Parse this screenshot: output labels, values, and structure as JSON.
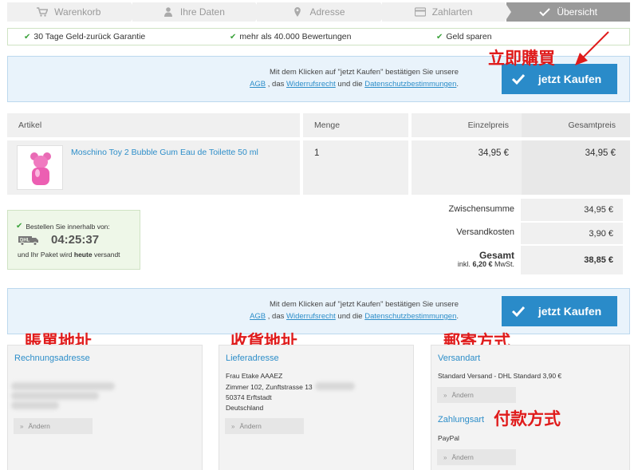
{
  "steps": [
    {
      "label": "Warenkorb",
      "icon": "cart-icon"
    },
    {
      "label": "Ihre Daten",
      "icon": "user-icon"
    },
    {
      "label": "Adresse",
      "icon": "map-pin-icon"
    },
    {
      "label": "Zahlarten",
      "icon": "credit-card-icon"
    },
    {
      "label": "Übersicht",
      "icon": "check-icon"
    }
  ],
  "guarantees": [
    "30 Tage Geld-zurück Garantie",
    "mehr als 40.000 Bewertungen",
    "Geld sparen"
  ],
  "confirm": {
    "line1": "Mit dem Klicken auf \"jetzt Kaufen\" bestätigen Sie unsere",
    "agb": "AGB",
    "sep1": ", das",
    "widerruf": "Widerrufsrecht",
    "sep2": "und die",
    "datenschutz": "Datenschutzbestimmungen",
    "end": ".",
    "button": "jetzt Kaufen"
  },
  "annotations": {
    "buy_now": "立即購買",
    "billing": "賬單地址",
    "shipping": "收貨地址",
    "delivery": "郵寄方式",
    "payment": "付款方式"
  },
  "table": {
    "headers": {
      "article": "Artikel",
      "qty": "Menge",
      "unit": "Einzelpreis",
      "total": "Gesamtpreis"
    },
    "item": {
      "name": "Moschino Toy 2 Bubble Gum Eau de Toilette 50 ml",
      "qty": "1",
      "unit": "34,95 €",
      "total": "34,95 €"
    }
  },
  "summary": {
    "subtotal_label": "Zwischensumme",
    "subtotal": "34,95 €",
    "shipping_label": "Versandkosten",
    "shipping": "3,90 €",
    "total_label": "Gesamt",
    "vat_prefix": "inkl.",
    "vat_amount": "6,20 €",
    "vat_suffix": "MwSt.",
    "total": "38,85 €"
  },
  "delivery": {
    "line1": "Bestellen Sie innerhalb von:",
    "timer": "04:25:37",
    "line3a": "und Ihr Paket wird",
    "line3b": "heute",
    "line3c": "versandt",
    "carrier": "DHL"
  },
  "billing": {
    "title": "Rechnungsadresse",
    "edit": "Ändern"
  },
  "shipping_addr": {
    "title": "Lieferadresse",
    "name": "Frau Etake AAAEZ",
    "street": "Zimmer 102, Zunftstrasse 13",
    "city": "50374 Erftstadt",
    "country": "Deutschland",
    "edit": "Ändern"
  },
  "shipping_method": {
    "title": "Versandart",
    "value": "Standard Versand - DHL Standard 3,90 €",
    "edit": "Ändern"
  },
  "payment": {
    "title": "Zahlungsart",
    "value": "PayPal",
    "edit": "Ändern"
  },
  "colors": {
    "accent": "#2a8bc9",
    "link": "#2d8ec9",
    "success": "#3ca33c",
    "annotation": "#e01b1b"
  }
}
